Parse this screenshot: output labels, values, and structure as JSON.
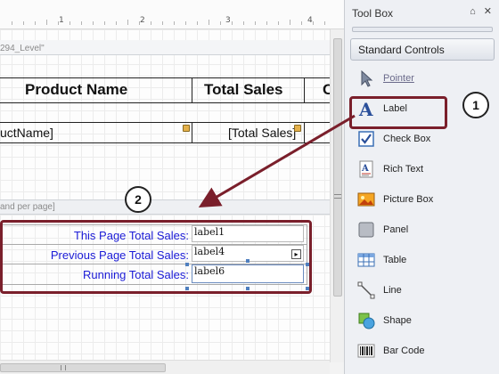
{
  "ruler": {
    "marks": [
      "1",
      "2",
      "3",
      "4"
    ]
  },
  "designer": {
    "group_band_label": "294_Level\"",
    "header": {
      "product_name": "Product Name",
      "total_sales": "Total Sales",
      "partial_col": "C"
    },
    "detail": {
      "product_name_field": "uctName]",
      "total_sales_field": "[Total Sales]"
    },
    "footer_band_label": "and per page]",
    "footer": {
      "rows": [
        {
          "label": "This Page Total Sales:",
          "value": "label1"
        },
        {
          "label": "Previous Page Total Sales:",
          "value": "label4"
        },
        {
          "label": "Running Total Sales:",
          "value": "label6"
        }
      ]
    }
  },
  "toolbox": {
    "title": "Tool Box",
    "section": "Standard Controls",
    "items": [
      {
        "label": "Pointer",
        "icon": "pointer-icon"
      },
      {
        "label": "Label",
        "icon": "label-icon"
      },
      {
        "label": "Check Box",
        "icon": "checkbox-icon"
      },
      {
        "label": "Rich Text",
        "icon": "rich-text-icon"
      },
      {
        "label": "Picture Box",
        "icon": "picture-box-icon"
      },
      {
        "label": "Panel",
        "icon": "panel-icon"
      },
      {
        "label": "Table",
        "icon": "table-icon"
      },
      {
        "label": "Line",
        "icon": "line-icon"
      },
      {
        "label": "Shape",
        "icon": "shape-icon"
      },
      {
        "label": "Bar Code",
        "icon": "barcode-icon"
      }
    ]
  },
  "callouts": {
    "badge1": "1",
    "badge2": "2",
    "color": "#7a1f2b"
  }
}
